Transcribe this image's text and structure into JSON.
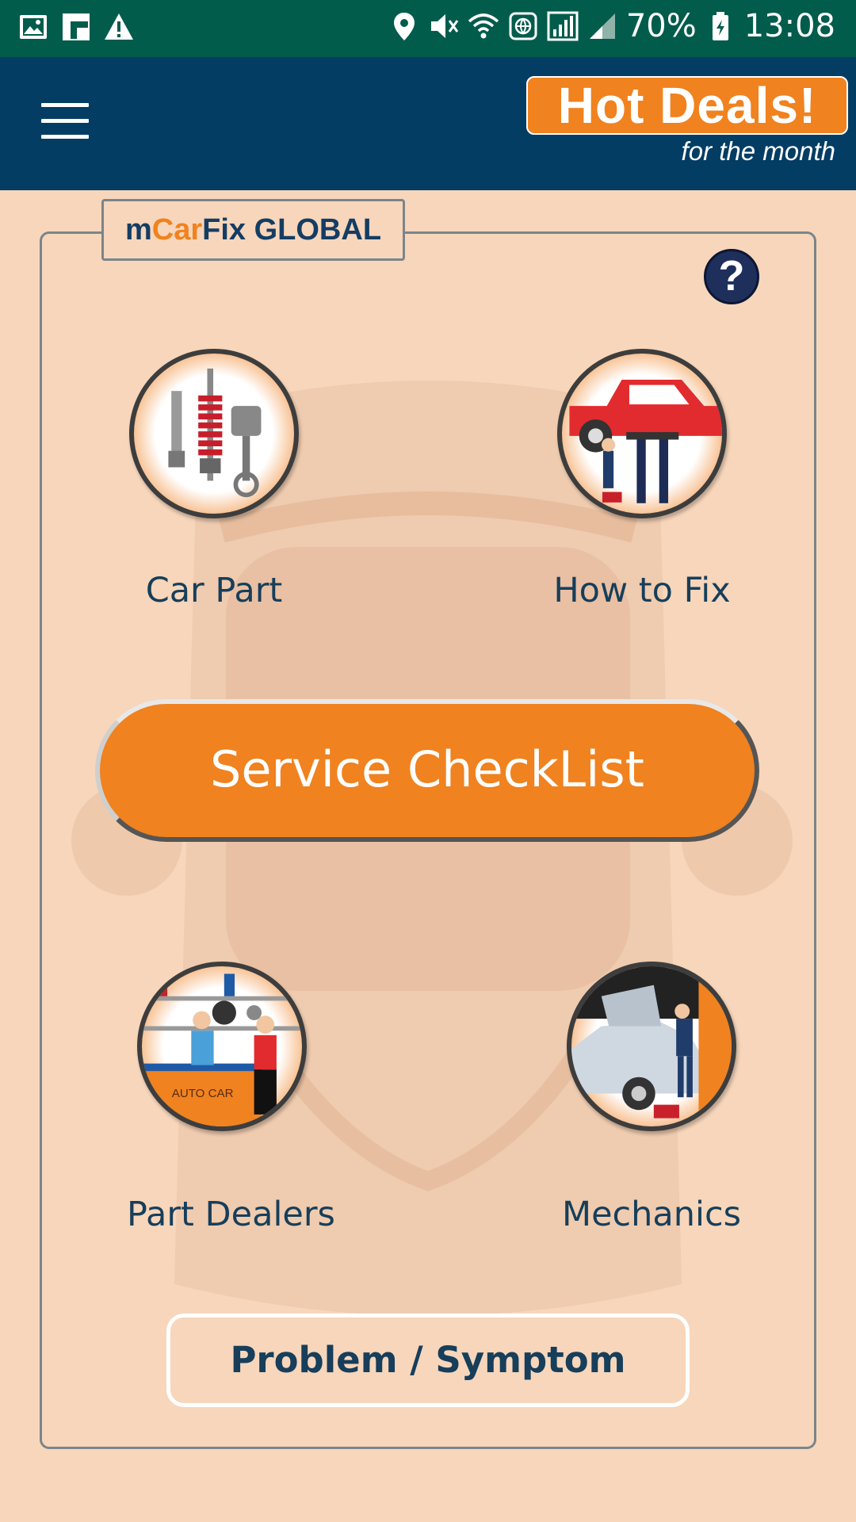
{
  "status_bar": {
    "battery": "70%",
    "time": "13:08",
    "icons": [
      "image-icon",
      "flipboard-icon",
      "warning-icon",
      "location-icon",
      "mute-icon",
      "wifi-icon",
      "vpn-icon",
      "signal-icon",
      "battery-icon"
    ]
  },
  "app_bar": {
    "menu_icon": "hamburger-menu-icon",
    "hot_deals_title": "Hot Deals!",
    "hot_deals_subtitle": "for the month"
  },
  "panel": {
    "logo": {
      "part1": "m",
      "part2": "Car",
      "part3": "Fix GLOBAL"
    },
    "help_icon": "?",
    "tiles": [
      {
        "label": "Car Part",
        "icon": "car-parts-icon"
      },
      {
        "label": "How to Fix",
        "icon": "car-lift-repair-icon"
      },
      {
        "label": "Part Dealers",
        "icon": "parts-dealer-icon"
      },
      {
        "label": "Mechanics",
        "icon": "mechanic-icon"
      }
    ],
    "service_checklist_label": "Service CheckList",
    "problem_symptom_label": "Problem / Symptom"
  },
  "colors": {
    "status_bar": "#025c4c",
    "app_bar": "#043d63",
    "accent_orange": "#f0821f",
    "background": "#f7d6bb",
    "text_dark": "#173e5a"
  }
}
